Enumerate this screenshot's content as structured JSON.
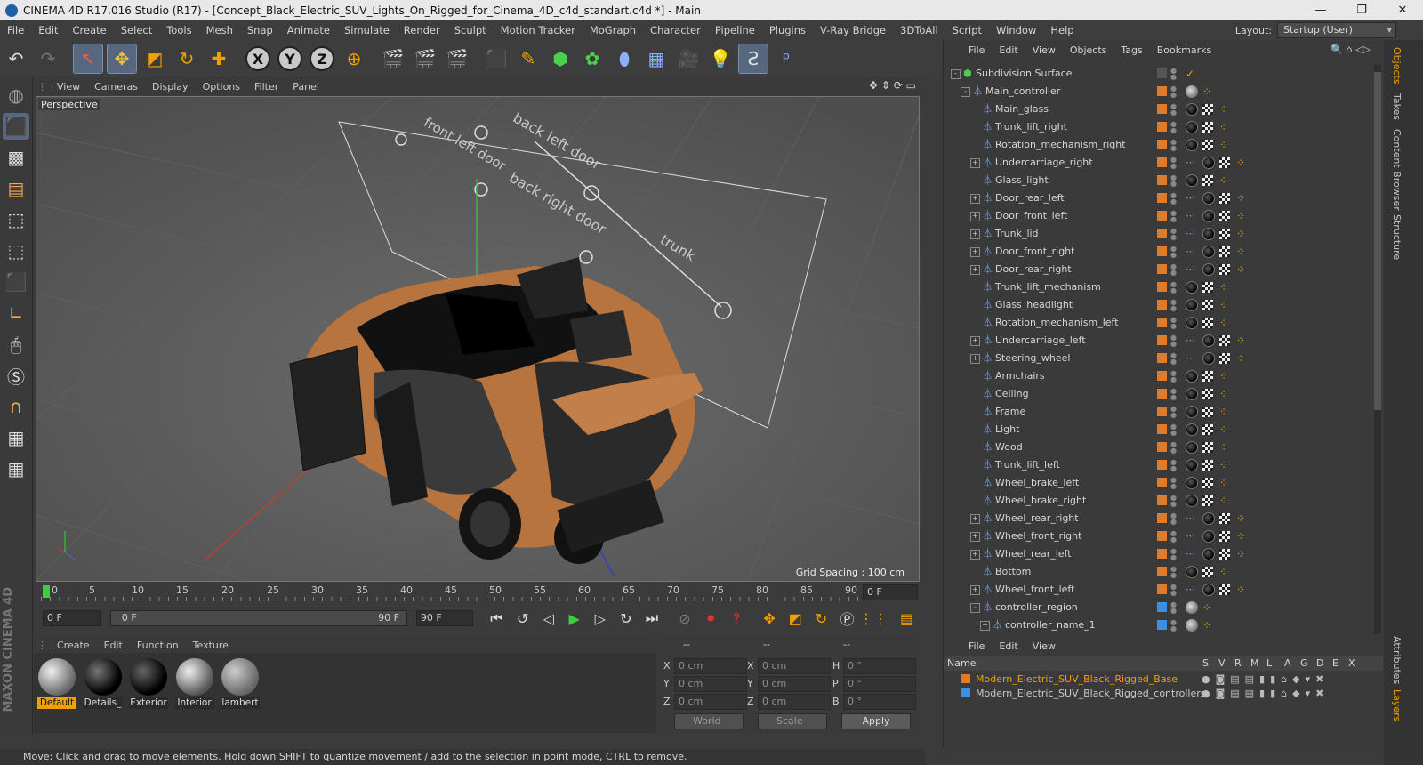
{
  "window": {
    "title": "CINEMA 4D R17.016 Studio (R17) - [Concept_Black_Electric_SUV_Lights_On_Rigged_for_Cinema_4D_c4d_standart.c4d *] - Main",
    "minimize": "—",
    "maximize": "❐",
    "close": "✕"
  },
  "menu": [
    "File",
    "Edit",
    "Create",
    "Select",
    "Tools",
    "Mesh",
    "Snap",
    "Animate",
    "Simulate",
    "Render",
    "Sculpt",
    "Motion Tracker",
    "MoGraph",
    "Character",
    "Pipeline",
    "Plugins",
    "V-Ray Bridge",
    "3DToAll",
    "Script",
    "Window",
    "Help"
  ],
  "layout": {
    "label": "Layout:",
    "value": "Startup (User)"
  },
  "viewport": {
    "menu": [
      "View",
      "Cameras",
      "Display",
      "Options",
      "Filter",
      "Panel"
    ],
    "label": "Perspective",
    "grid_spacing": "Grid Spacing : 100 cm",
    "ghost_labels": [
      "front left door",
      "back left door",
      "back right door",
      "trunk"
    ]
  },
  "timeline": {
    "ticks": [
      "0",
      "5",
      "10",
      "15",
      "20",
      "25",
      "30",
      "35",
      "40",
      "45",
      "50",
      "55",
      "60",
      "65",
      "70",
      "75",
      "80",
      "85",
      "90"
    ],
    "current_frame": "0 F",
    "start": "0 F",
    "range_start": "0 F",
    "range_end": "90 F",
    "end": "90 F"
  },
  "materials": {
    "menu": [
      "Create",
      "Edit",
      "Function",
      "Texture"
    ],
    "items": [
      {
        "name": "Default",
        "selected": true
      },
      {
        "name": "Details_",
        "selected": false
      },
      {
        "name": "Exterior",
        "selected": false
      },
      {
        "name": "Interior",
        "selected": false
      },
      {
        "name": "lambert",
        "selected": false
      }
    ]
  },
  "coords": {
    "headers": [
      "--",
      "--",
      "--"
    ],
    "rows": [
      {
        "a": "X",
        "av": "0 cm",
        "b": "X",
        "bv": "0 cm",
        "c": "H",
        "cv": "0 °"
      },
      {
        "a": "Y",
        "av": "0 cm",
        "b": "Y",
        "bv": "0 cm",
        "c": "P",
        "cv": "0 °"
      },
      {
        "a": "Z",
        "av": "0 cm",
        "b": "Z",
        "bv": "0 cm",
        "c": "B",
        "cv": "0 °"
      }
    ],
    "world": "World",
    "scale": "Scale",
    "apply": "Apply"
  },
  "status": "Move: Click and drag to move elements. Hold down SHIFT to quantize movement / add to the selection in point mode, CTRL to remove.",
  "objects": {
    "menu": [
      "File",
      "Edit",
      "View",
      "Objects",
      "Tags",
      "Bookmarks"
    ],
    "items": [
      {
        "name": "Subdivision Surface",
        "depth": 0,
        "exp": "-",
        "layer": "none"
      },
      {
        "name": "Main_controller",
        "depth": 1,
        "exp": "-",
        "layer": "orange"
      },
      {
        "name": "Main_glass",
        "depth": 2,
        "exp": "",
        "layer": "orange"
      },
      {
        "name": "Trunk_lift_right",
        "depth": 2,
        "exp": "",
        "layer": "orange"
      },
      {
        "name": "Rotation_mechanism_right",
        "depth": 2,
        "exp": "",
        "layer": "orange"
      },
      {
        "name": "Undercarriage_right",
        "depth": 2,
        "exp": "+",
        "layer": "orange"
      },
      {
        "name": "Glass_light",
        "depth": 2,
        "exp": "",
        "layer": "orange"
      },
      {
        "name": "Door_rear_left",
        "depth": 2,
        "exp": "+",
        "layer": "orange"
      },
      {
        "name": "Door_front_left",
        "depth": 2,
        "exp": "+",
        "layer": "orange"
      },
      {
        "name": "Trunk_lid",
        "depth": 2,
        "exp": "+",
        "layer": "orange"
      },
      {
        "name": "Door_front_right",
        "depth": 2,
        "exp": "+",
        "layer": "orange"
      },
      {
        "name": "Door_rear_right",
        "depth": 2,
        "exp": "+",
        "layer": "orange"
      },
      {
        "name": "Trunk_lift_mechanism",
        "depth": 2,
        "exp": "",
        "layer": "orange"
      },
      {
        "name": "Glass_headlight",
        "depth": 2,
        "exp": "",
        "layer": "orange"
      },
      {
        "name": "Rotation_mechanism_left",
        "depth": 2,
        "exp": "",
        "layer": "orange"
      },
      {
        "name": "Undercarriage_left",
        "depth": 2,
        "exp": "+",
        "layer": "orange"
      },
      {
        "name": "Steering_wheel",
        "depth": 2,
        "exp": "+",
        "layer": "orange"
      },
      {
        "name": "Armchairs",
        "depth": 2,
        "exp": "",
        "layer": "orange"
      },
      {
        "name": "Ceiling",
        "depth": 2,
        "exp": "",
        "layer": "orange"
      },
      {
        "name": "Frame",
        "depth": 2,
        "exp": "",
        "layer": "orange"
      },
      {
        "name": "Light",
        "depth": 2,
        "exp": "",
        "layer": "orange"
      },
      {
        "name": "Wood",
        "depth": 2,
        "exp": "",
        "layer": "orange"
      },
      {
        "name": "Trunk_lift_left",
        "depth": 2,
        "exp": "",
        "layer": "orange"
      },
      {
        "name": "Wheel_brake_left",
        "depth": 2,
        "exp": "",
        "layer": "orange"
      },
      {
        "name": "Wheel_brake_right",
        "depth": 2,
        "exp": "",
        "layer": "orange"
      },
      {
        "name": "Wheel_rear_right",
        "depth": 2,
        "exp": "+",
        "layer": "orange"
      },
      {
        "name": "Wheel_front_right",
        "depth": 2,
        "exp": "+",
        "layer": "orange"
      },
      {
        "name": "Wheel_rear_left",
        "depth": 2,
        "exp": "+",
        "layer": "orange"
      },
      {
        "name": "Bottom",
        "depth": 2,
        "exp": "",
        "layer": "orange"
      },
      {
        "name": "Wheel_front_left",
        "depth": 2,
        "exp": "+",
        "layer": "orange"
      },
      {
        "name": "controller_region",
        "depth": 2,
        "exp": "-",
        "layer": "blue"
      },
      {
        "name": "controller_name_1",
        "depth": 3,
        "exp": "+",
        "layer": "blue"
      }
    ]
  },
  "layers": {
    "menu": [
      "File",
      "Edit",
      "View"
    ],
    "header_name": "Name",
    "header_flags": [
      "S",
      "V",
      "R",
      "M",
      "L",
      "A",
      "G",
      "D",
      "E",
      "X"
    ],
    "items": [
      {
        "name": "Modern_Electric_SUV_Black_Rigged_Base",
        "color": "#e07b2a",
        "highlight": true
      },
      {
        "name": "Modern_Electric_SUV_Black_Rigged_controllers",
        "color": "#3d8fe0",
        "highlight": false
      }
    ]
  },
  "right_tabs": [
    "Objects",
    "Takes",
    "Content Browser",
    "Structure",
    "Attributes",
    "Layers"
  ],
  "colors": {
    "accent": "#f0a000",
    "orange_layer": "#e07b2a",
    "blue_layer": "#3d8fe0"
  },
  "brand": "MAXON CINEMA 4D"
}
